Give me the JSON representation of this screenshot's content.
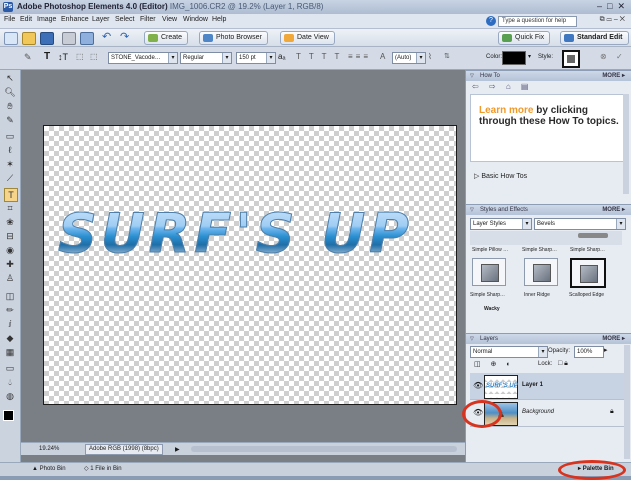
{
  "title": {
    "app": "Adobe Photoshop Elements 4.0 (Editor)",
    "doc": "IMG_1006.CR2 @ 19.2% (Layer 1, RGB/8)"
  },
  "menu": [
    "File",
    "Edit",
    "Image",
    "Enhance",
    "Layer",
    "Select",
    "Filter",
    "View",
    "Window",
    "Help"
  ],
  "help": {
    "placeholder": "Type a question for help"
  },
  "shortcuts": {
    "create": "Create",
    "photo_browser": "Photo Browser",
    "date_view": "Date View",
    "quick_fix": "Quick Fix",
    "standard_edit": "Standard Edit"
  },
  "options": {
    "font": "STONE_Vacode…",
    "style": "Regular",
    "size": "150 pt",
    "leading": "(Auto)",
    "color_label": "Color:",
    "style_label": "Style:"
  },
  "canvas": {
    "text": "SURF'S  UP"
  },
  "status": {
    "zoom": "19.24%",
    "info": "Adobe RGB (1998) (8bpc)"
  },
  "panels": {
    "howto": {
      "title": "How To",
      "more": "MORE ▸",
      "headline_link": "Learn more",
      "headline_rest": "by clicking through these How To topics.",
      "link": "Basic How Tos"
    },
    "styles": {
      "title": "Styles and Effects",
      "more": "MORE ▸",
      "category": "Layer Styles",
      "subcat": "Bevels",
      "items": [
        "Simple Pillow …",
        "Simple Sharp…",
        "Simple Sharp…",
        "Simple Sharp…",
        "Inner Ridge",
        "Scalloped Edge"
      ],
      "footer": "Wacky"
    },
    "layers": {
      "title": "Layers",
      "more": "MORE ▸",
      "mode": "Normal",
      "opacity_label": "Opacity:",
      "opacity": "100%",
      "lock_label": "Lock:",
      "items": [
        {
          "name": "Layer 1",
          "thumb": "SURF'S UP"
        },
        {
          "name": "Background"
        }
      ]
    }
  },
  "bottombar": {
    "photo_bin": "Photo Bin",
    "files": "1 File in Bin",
    "palette_bin": "Palette Bin"
  }
}
